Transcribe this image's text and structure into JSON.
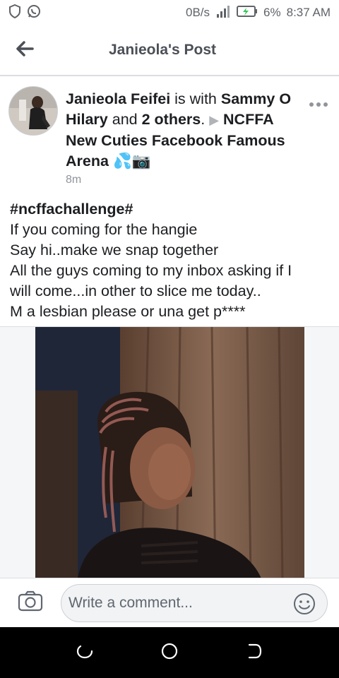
{
  "status_bar": {
    "net_speed": "0B/s",
    "battery": "6%",
    "time": "8:37 AM",
    "icons": [
      "shield-icon",
      "whatsapp-icon",
      "signal-icon",
      "battery-charging-icon"
    ]
  },
  "header": {
    "title": "Janieola's Post",
    "back_icon": "arrow-left-icon"
  },
  "post": {
    "author": "Janieola Feifei",
    "with_text": " is with ",
    "tagged": "Sammy O Hilary",
    "and_text": " and ",
    "others": "2 others",
    "period": ".",
    "arrow": "▶",
    "group": "NCFFA New Cuties Facebook Famous Arena",
    "emoji": "💦📷",
    "time": "8m",
    "lines": [
      "#ncffachallenge#",
      "If you coming for the hangie",
      "Say hi..make we snap together",
      "All the guys coming to my inbox asking if I",
      "will come...in other to slice me today..",
      "M a lesbian please or una get p****"
    ]
  },
  "comment": {
    "placeholder": "Write a comment..."
  },
  "colors": {
    "text": "#1c1e21",
    "muted": "#90949c",
    "header_title": "#4b4f56",
    "divider": "#dadde1",
    "nav_bg": "#000000"
  }
}
